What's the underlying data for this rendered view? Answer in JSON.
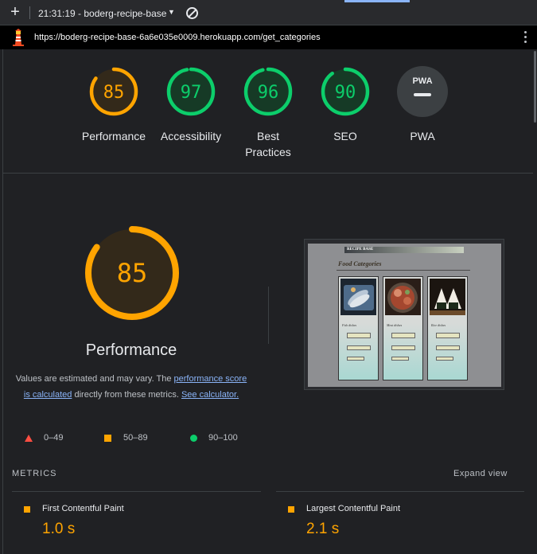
{
  "browser": {
    "time": "21:31:19",
    "tab_title": "boderg-recipe-base",
    "title_full": "21:31:19 - boderg-recipe-base",
    "url": "https://boderg-recipe-base-6a6e035e0009.herokuapp.com/get_categories"
  },
  "colors": {
    "pass": "#0cce6b",
    "average": "#ffa400",
    "fail": "#ff4e42",
    "pwa": "#bdc1c6"
  },
  "scores": [
    {
      "value": "85",
      "label": "Performance",
      "rating": "average"
    },
    {
      "value": "97",
      "label": "Accessibility",
      "rating": "pass"
    },
    {
      "value": "96",
      "label": "Best Practices",
      "rating": "pass"
    },
    {
      "value": "90",
      "label": "SEO",
      "rating": "pass"
    },
    {
      "value": "",
      "label": "PWA",
      "rating": "pwa",
      "badge": "PWA"
    }
  ],
  "performance": {
    "score": "85",
    "title": "Performance",
    "desc_part1": "Values are estimated and may vary. The ",
    "link1": "performance score is calculated",
    "desc_part2": " directly from these metrics. ",
    "link2": "See calculator."
  },
  "legend": {
    "fail": "0–49",
    "average": "50–89",
    "pass": "90–100"
  },
  "screenshot": {
    "nav_brand": "RECIPE BASE",
    "heading": "Food Categories",
    "cards": [
      "Fish dishes",
      "Meat dishes",
      "Rice dishes"
    ]
  },
  "metrics": {
    "section_label": "METRICS",
    "expand_label": "Expand view",
    "items": [
      {
        "name": "First Contentful Paint",
        "value": "1.0 s",
        "rating": "average"
      },
      {
        "name": "Largest Contentful Paint",
        "value": "2.1 s",
        "rating": "average"
      }
    ]
  }
}
